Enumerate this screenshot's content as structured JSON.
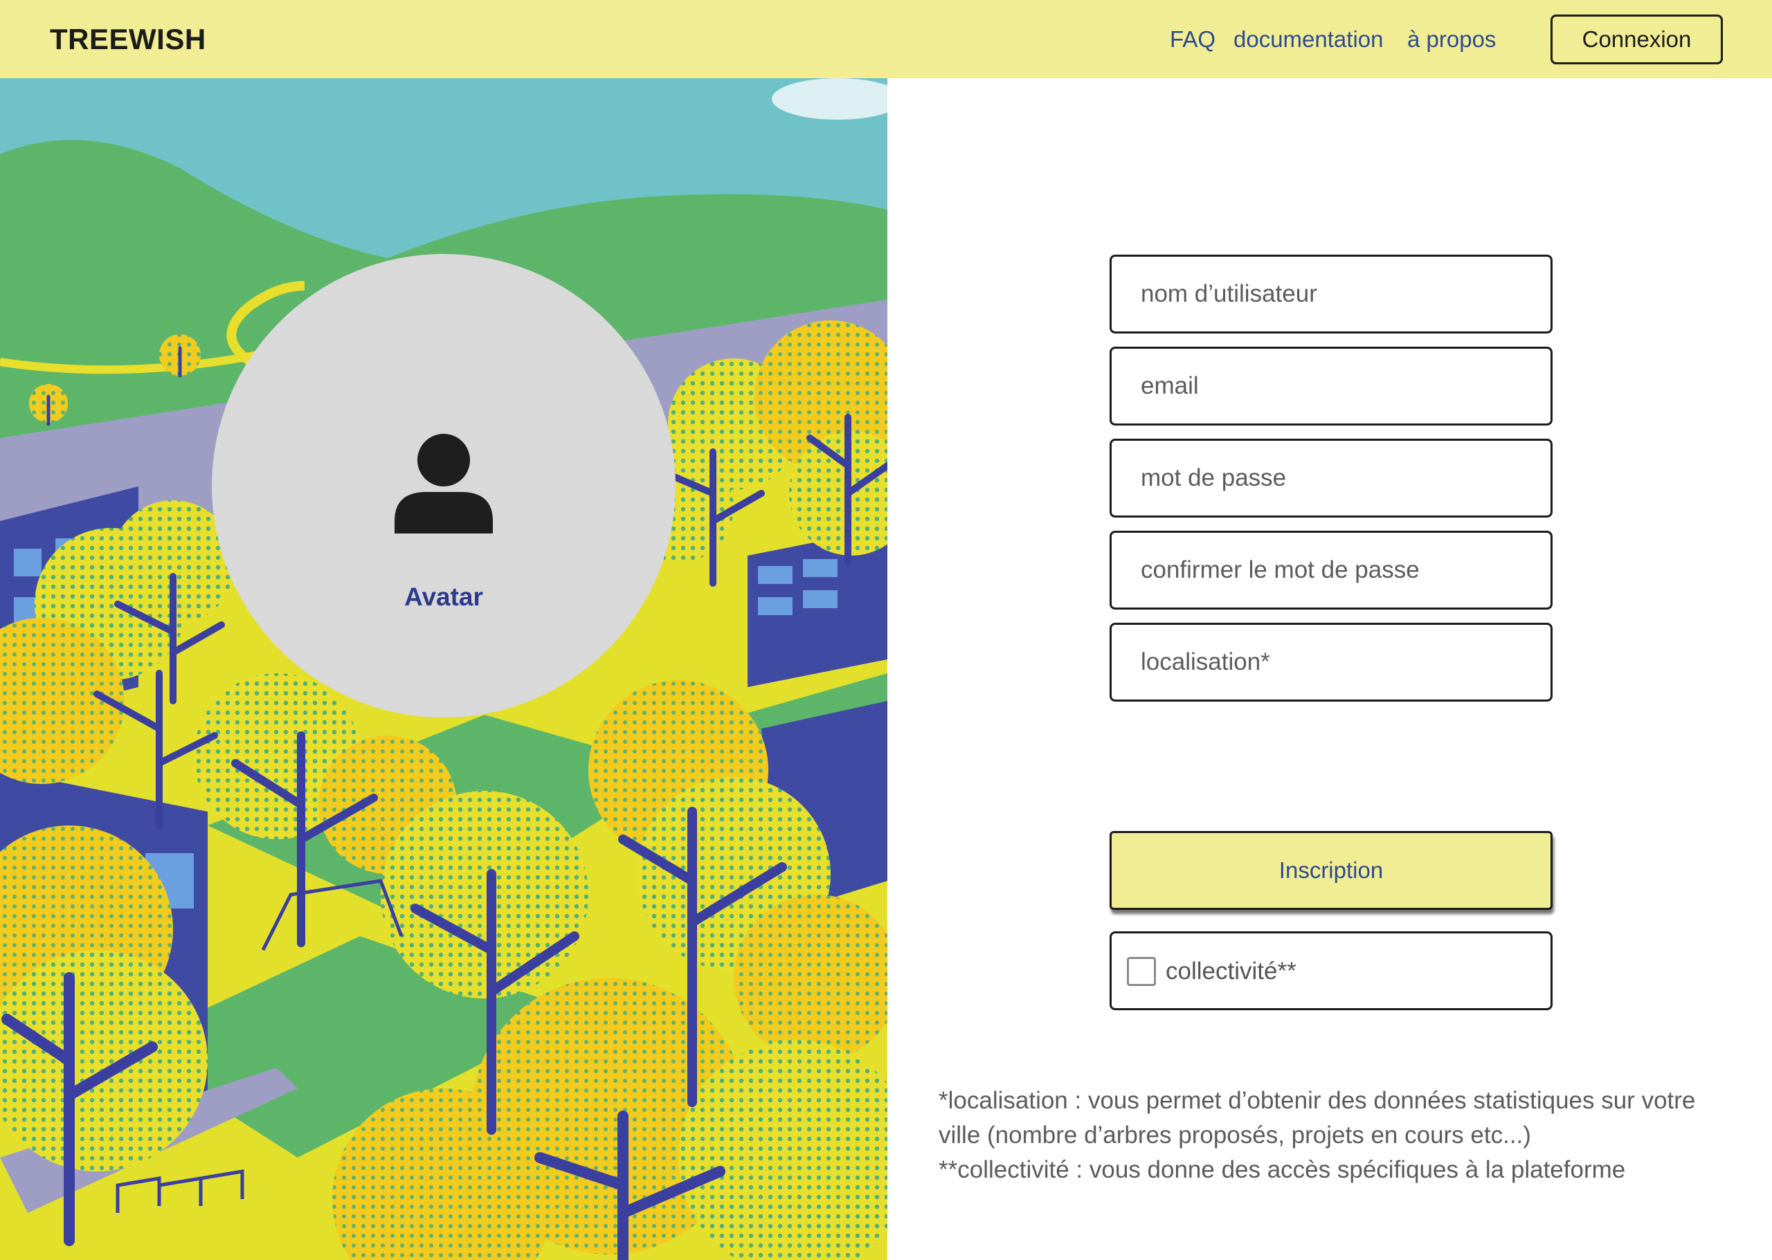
{
  "header": {
    "logo": "TREEWISH",
    "nav": {
      "faq": "FAQ",
      "documentation": "documentation",
      "about": "à propos"
    },
    "login_label": "Connexion"
  },
  "avatar": {
    "icon": "person-icon",
    "label": "Avatar"
  },
  "form": {
    "username_placeholder": "nom d’utilisateur",
    "email_placeholder": "email",
    "password_placeholder": "mot de passe",
    "confirm_password_placeholder": "confirmer le mot de passe",
    "location_placeholder": "localisation*",
    "submit_label": "Inscription",
    "collectivity_label": "collectivité**",
    "collectivity_checked": false
  },
  "notes": {
    "line1": "*localisation : vous permet d’obtenir des données statistiques sur votre",
    "line2": "ville (nombre d’arbres proposés, projets en cours etc...)",
    "line3": "**collectivité : vous donne des accès spécifiques à la plateforme"
  },
  "colors": {
    "header_bg": "#f1ed94",
    "link": "#2e4a8e",
    "avatar_bg": "#d9d9d9",
    "avatar_label": "#2e3a8c",
    "sky": "#6fc3c8",
    "grass": "#5db56a",
    "tree_yellow": "#f2cb1f",
    "trunk_blue": "#3a3fa0"
  }
}
